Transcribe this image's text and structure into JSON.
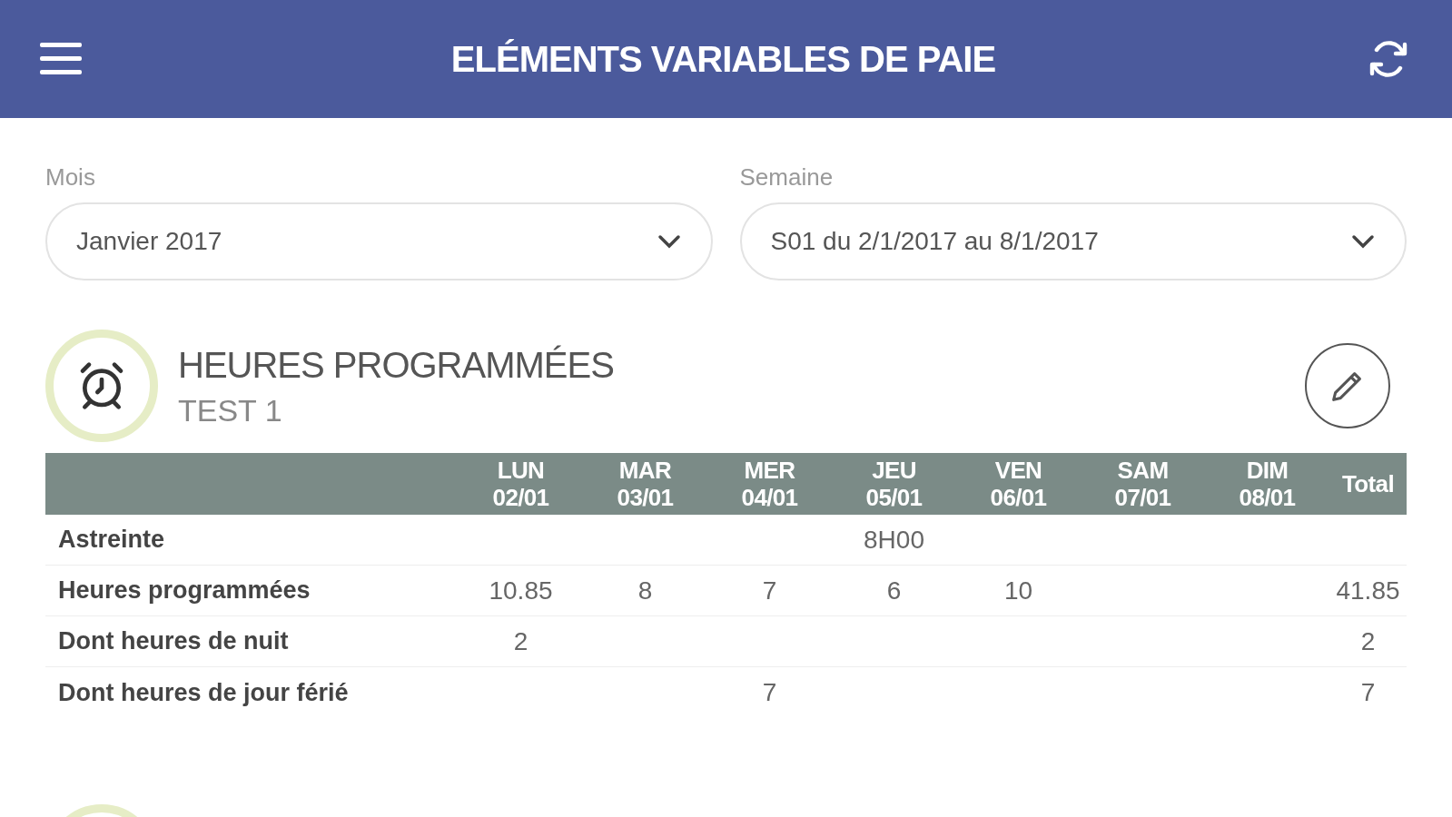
{
  "header": {
    "title": "ELÉMENTS VARIABLES DE PAIE"
  },
  "filters": [
    {
      "label": "Mois",
      "value": "Janvier 2017"
    },
    {
      "label": "Semaine",
      "value": "S01 du 2/1/2017 au 8/1/2017"
    }
  ],
  "section": {
    "title": "HEURES PROGRAMMÉES",
    "subtitle": "TEST 1"
  },
  "table": {
    "columns": [
      {
        "day": "LUN",
        "date": "02/01"
      },
      {
        "day": "MAR",
        "date": "03/01"
      },
      {
        "day": "MER",
        "date": "04/01"
      },
      {
        "day": "JEU",
        "date": "05/01"
      },
      {
        "day": "VEN",
        "date": "06/01"
      },
      {
        "day": "SAM",
        "date": "07/01"
      },
      {
        "day": "DIM",
        "date": "08/01"
      },
      {
        "day": "Total"
      }
    ],
    "rows": [
      {
        "label": "Astreinte",
        "cells": [
          null,
          null,
          null,
          "8H00",
          null,
          null,
          null,
          null
        ]
      },
      {
        "label": "Heures programmées",
        "cells": [
          "10.85",
          "8",
          "7",
          "6",
          "10",
          null,
          null,
          "41.85"
        ]
      },
      {
        "label": "Dont heures de nuit",
        "cells": [
          "2",
          null,
          null,
          null,
          null,
          null,
          null,
          "2"
        ]
      },
      {
        "label": "Dont heures de jour férié",
        "cells": [
          null,
          null,
          "7",
          null,
          null,
          null,
          null,
          "7"
        ]
      }
    ]
  }
}
